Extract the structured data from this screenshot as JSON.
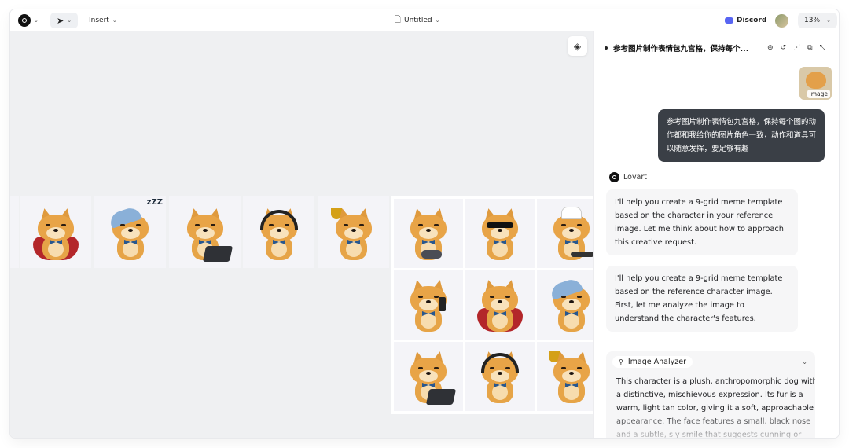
{
  "topbar": {
    "insert_label": "Insert",
    "doc_title": "Untitled",
    "discord_label": "Discord",
    "zoom": "13%"
  },
  "canvas": {
    "strip_tiles": [
      "superhero",
      "sleeping",
      "laptop",
      "headphones",
      "trophy"
    ],
    "grid_tiles": [
      "gamer",
      "sunglasses",
      "chef",
      "phone",
      "superhero",
      "sleeping",
      "laptop",
      "headphones",
      "trophy"
    ]
  },
  "chat": {
    "title": "参考图片制作表情包九宫格，保持每个...",
    "attachment_tag": "Image",
    "user_message": "参考图片制作表情包九宫格，保持每个图的动作都和我给你的图片角色一致，动作和道具可以随意发挥，要足够有趣",
    "assistant_name": "Lovart",
    "reply_1": "I'll help you create a 9-grid meme template based on the character in your reference image. Let me think about how to approach this creative request.",
    "reply_2": "I'll help you create a 9-grid meme template based on the reference character image. First, let me analyze the image to understand the character's features.",
    "tool_name": "Image Analyzer",
    "tool_output": "This character is a plush, anthropomorphic dog with a distinctive, mischievous expression. Its fur is a warm, light tan color, giving it a soft, approachable appearance. The face features a small, black nose and a subtle, sly smile that suggests cunning or"
  },
  "colors": {
    "accent_dark": "#3a3f46",
    "canvas_bg": "#eff0f2",
    "discord": "#5865f2",
    "fur": "#e6a447"
  }
}
